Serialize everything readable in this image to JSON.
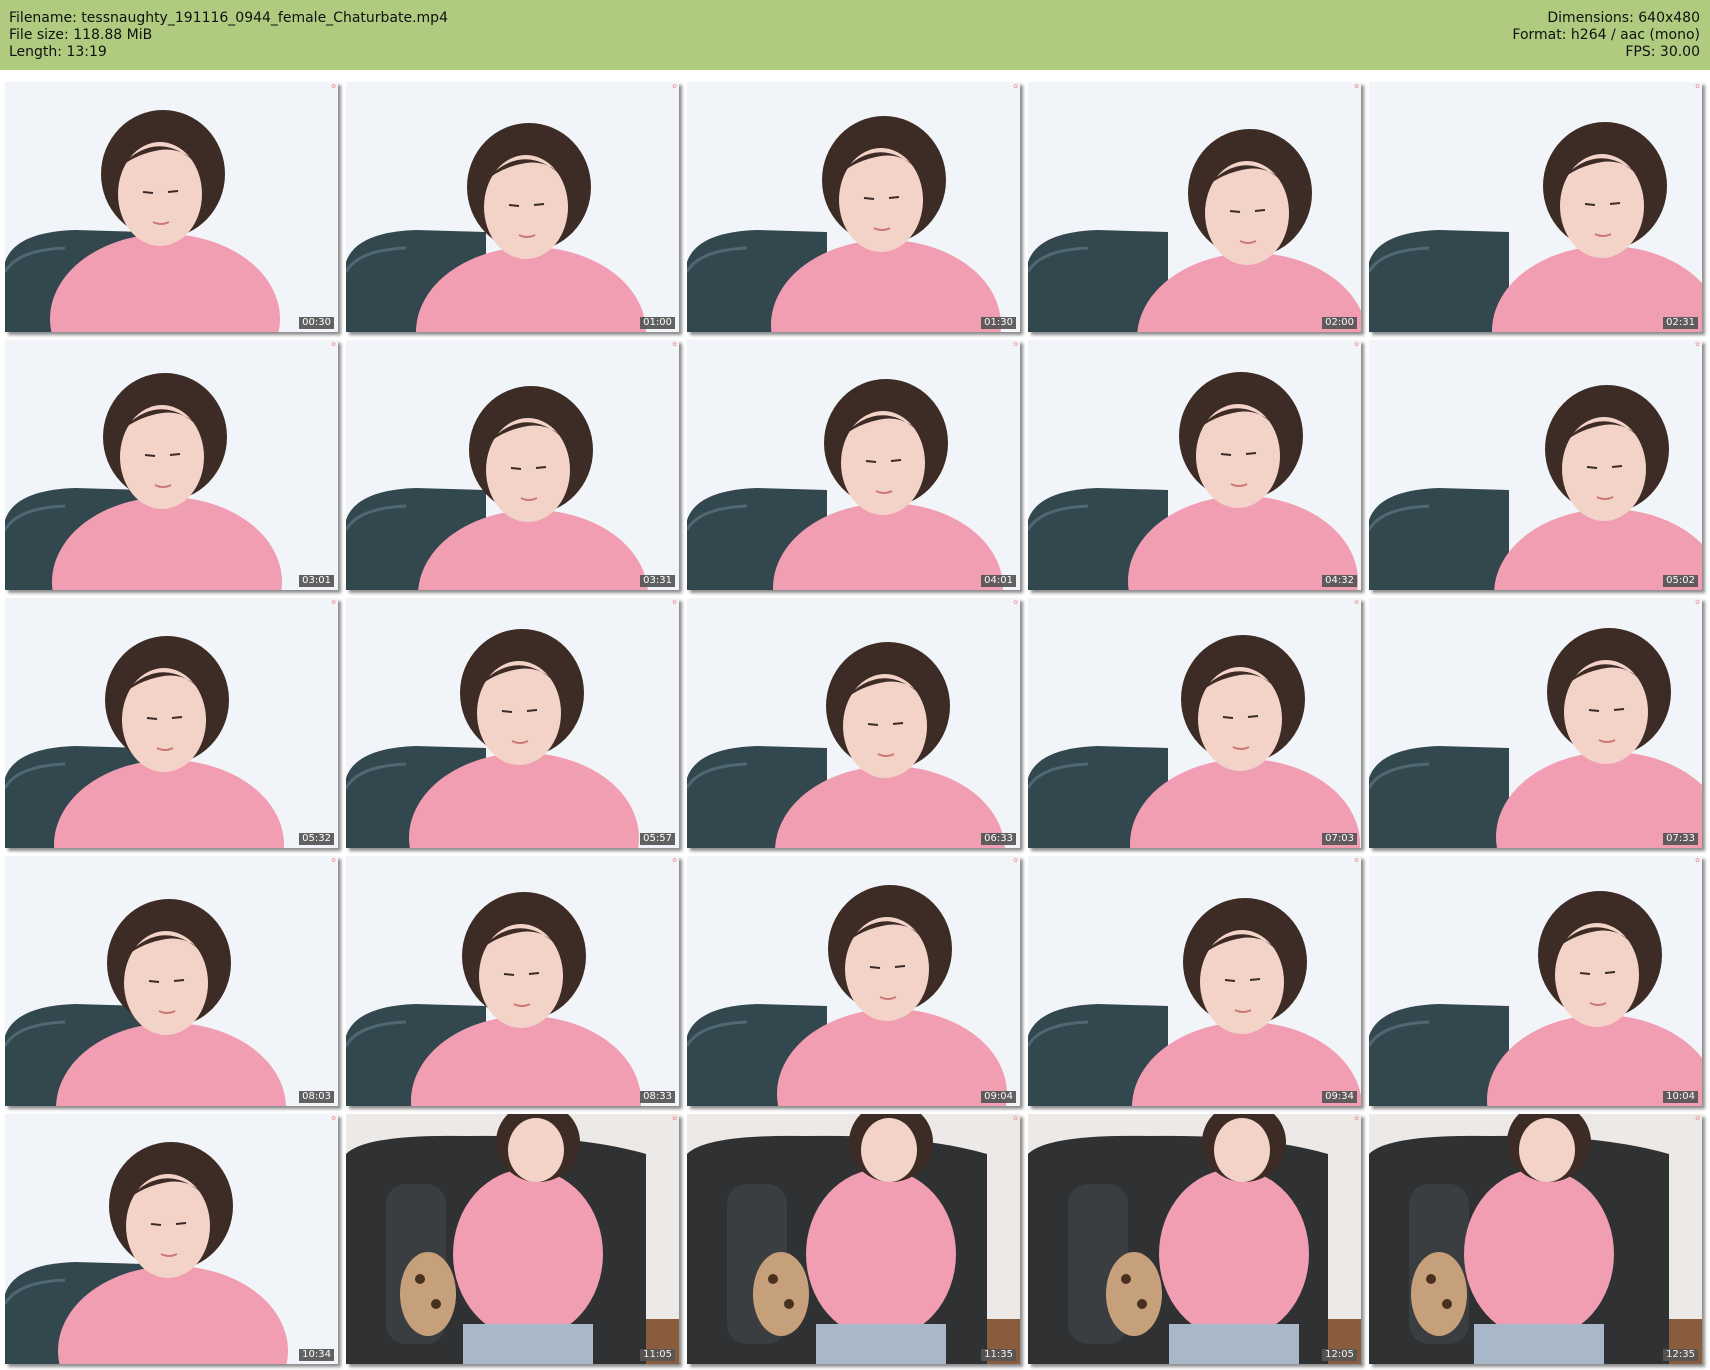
{
  "header": {
    "filename": "Filename: tessnaughty_191116_0944_female_Chaturbate.mp4",
    "file_size": "File size: 118.88 MiB",
    "length": "Length: 13:19",
    "dimensions": "Dimensions: 640x480",
    "format": "Format: h264 / aac (mono)",
    "fps": "FPS: 30.00"
  },
  "colors": {
    "header_bg": "#afcb7f",
    "sweater": "#f29eb2",
    "chair": "#33474f",
    "hair": "#3d2c25"
  },
  "thumbnails": [
    {
      "time": "00:30",
      "scene": "closeup"
    },
    {
      "time": "01:00",
      "scene": "closeup"
    },
    {
      "time": "01:30",
      "scene": "closeup"
    },
    {
      "time": "02:00",
      "scene": "closeup"
    },
    {
      "time": "02:31",
      "scene": "closeup"
    },
    {
      "time": "03:01",
      "scene": "closeup"
    },
    {
      "time": "03:31",
      "scene": "closeup"
    },
    {
      "time": "04:01",
      "scene": "closeup"
    },
    {
      "time": "04:32",
      "scene": "closeup"
    },
    {
      "time": "05:02",
      "scene": "closeup"
    },
    {
      "time": "05:32",
      "scene": "closeup"
    },
    {
      "time": "05:57",
      "scene": "closeup"
    },
    {
      "time": "06:33",
      "scene": "closeup"
    },
    {
      "time": "07:03",
      "scene": "closeup"
    },
    {
      "time": "07:33",
      "scene": "closeup"
    },
    {
      "time": "08:03",
      "scene": "closeup"
    },
    {
      "time": "08:33",
      "scene": "closeup"
    },
    {
      "time": "09:04",
      "scene": "closeup"
    },
    {
      "time": "09:34",
      "scene": "closeup"
    },
    {
      "time": "10:04",
      "scene": "closeup"
    },
    {
      "time": "10:34",
      "scene": "closeup"
    },
    {
      "time": "11:05",
      "scene": "wide"
    },
    {
      "time": "11:35",
      "scene": "wide"
    },
    {
      "time": "12:05",
      "scene": "wide"
    },
    {
      "time": "12:35",
      "scene": "wide"
    }
  ]
}
